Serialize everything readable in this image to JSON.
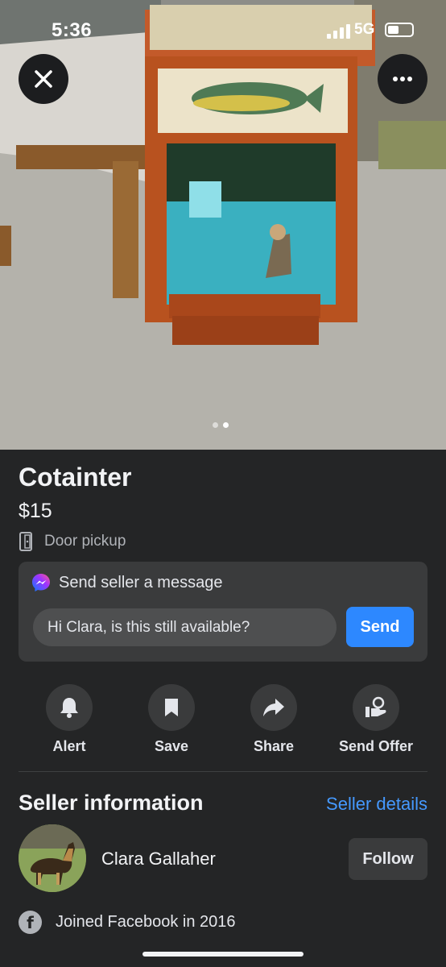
{
  "status_bar": {
    "time": "5:36",
    "network": "5G"
  },
  "listing": {
    "title": "Cotainter",
    "price": "$15",
    "pickup": "Door pickup",
    "photo_count": 2,
    "photo_index": 2
  },
  "message": {
    "header": "Send seller a message",
    "input_value": "Hi Clara, is this still available?",
    "send_label": "Send"
  },
  "actions": [
    {
      "label": "Alert",
      "icon": "bell-icon"
    },
    {
      "label": "Save",
      "icon": "bookmark-icon"
    },
    {
      "label": "Share",
      "icon": "share-arrow-icon"
    },
    {
      "label": "Send Offer",
      "icon": "offer-icon"
    }
  ],
  "seller": {
    "heading": "Seller information",
    "details_link": "Seller details",
    "name": "Clara Gallaher",
    "follow_label": "Follow",
    "joined": "Joined Facebook in 2016"
  },
  "colors": {
    "background": "#242526",
    "card": "#3a3b3c",
    "accent": "#2d88ff",
    "link": "#4599ff"
  }
}
